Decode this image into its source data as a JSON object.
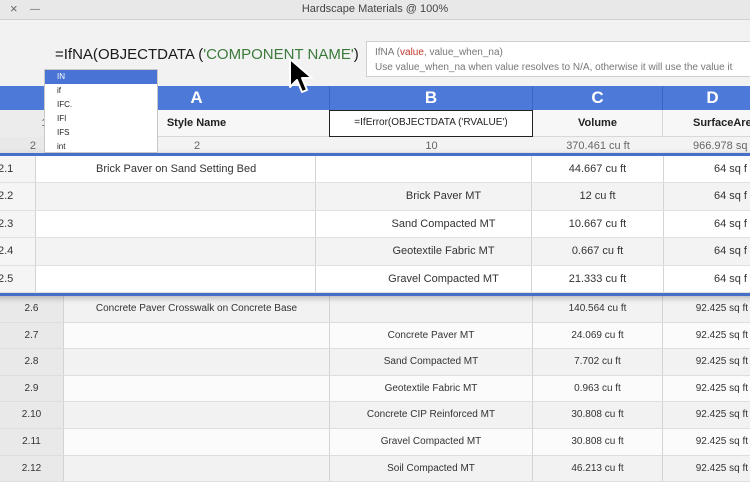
{
  "window": {
    "title": "Hardscape Materials @ 100%",
    "close_glyph": "×",
    "min_glyph": "—"
  },
  "formula_bar": {
    "prefix": "=IfNA(",
    "fn": "OBJECTDATA (",
    "str": "'COMPONENT NAME'",
    "suffix": ")"
  },
  "tooltip": {
    "fn_name": "IfNA (",
    "arg1": "value",
    "rest": ", value_when_na)",
    "description": "Use value_when_na when value resolves to N/A, otherwise it will use the value it"
  },
  "autocomplete": [
    "IN",
    "if",
    "IFC.",
    "IFI",
    "IFS",
    "int"
  ],
  "columns": [
    {
      "letter": "A",
      "header": "Style Name"
    },
    {
      "letter": "B",
      "header": "=IfError(OBJECTDATA ('RVALUE')"
    },
    {
      "letter": "C",
      "header": "Volume"
    },
    {
      "letter": "D",
      "header": "SurfaceAre"
    }
  ],
  "row1_num": "1",
  "peek": {
    "num": "2",
    "a": "2",
    "b": "10",
    "c": "370.461 cu ft",
    "d": "966.978 sq"
  },
  "zoom_rows": [
    {
      "num": "2.1",
      "a": "Brick Paver on Sand Setting Bed",
      "b": "",
      "c": "44.667 cu ft",
      "d": "64 sq f"
    },
    {
      "num": "2.2",
      "a": "",
      "b": "Brick Paver MT",
      "c": "12 cu ft",
      "d": "64 sq f"
    },
    {
      "num": "2.3",
      "a": "",
      "b": "Sand Compacted MT",
      "c": "10.667 cu ft",
      "d": "64 sq f"
    },
    {
      "num": "2.4",
      "a": "",
      "b": "Geotextile Fabric MT",
      "c": "0.667 cu ft",
      "d": "64 sq f"
    },
    {
      "num": "2.5",
      "a": "",
      "b": "Gravel Compacted MT",
      "c": "21.333 cu ft",
      "d": "64 sq f"
    }
  ],
  "rows": [
    {
      "num": "2.6",
      "a": "Concrete Paver Crosswalk on Concrete Base",
      "b": "",
      "c": "140.564 cu ft",
      "d": "92.425 sq ft"
    },
    {
      "num": "2.7",
      "a": "",
      "b": "Concrete Paver MT",
      "c": "24.069 cu ft",
      "d": "92.425 sq ft"
    },
    {
      "num": "2.8",
      "a": "",
      "b": "Sand Compacted MT",
      "c": "7.702 cu ft",
      "d": "92.425 sq ft"
    },
    {
      "num": "2.9",
      "a": "",
      "b": "Geotextile Fabric MT",
      "c": "0.963 cu ft",
      "d": "92.425 sq ft"
    },
    {
      "num": "2.10",
      "a": "",
      "b": "Concrete CIP Reinforced MT",
      "c": "30.808 cu ft",
      "d": "92.425 sq ft"
    },
    {
      "num": "2.11",
      "a": "",
      "b": "Gravel Compacted MT",
      "c": "30.808 cu ft",
      "d": "92.425 sq ft"
    },
    {
      "num": "2.12",
      "a": "",
      "b": "Soil Compacted MT",
      "c": "46.213 cu ft",
      "d": "92.425 sq ft"
    }
  ],
  "colors": {
    "accent": "#4d7ad8",
    "zoom_border": "#4670c8",
    "arg_red": "#c0392b",
    "string_green": "#3b7a3b"
  }
}
